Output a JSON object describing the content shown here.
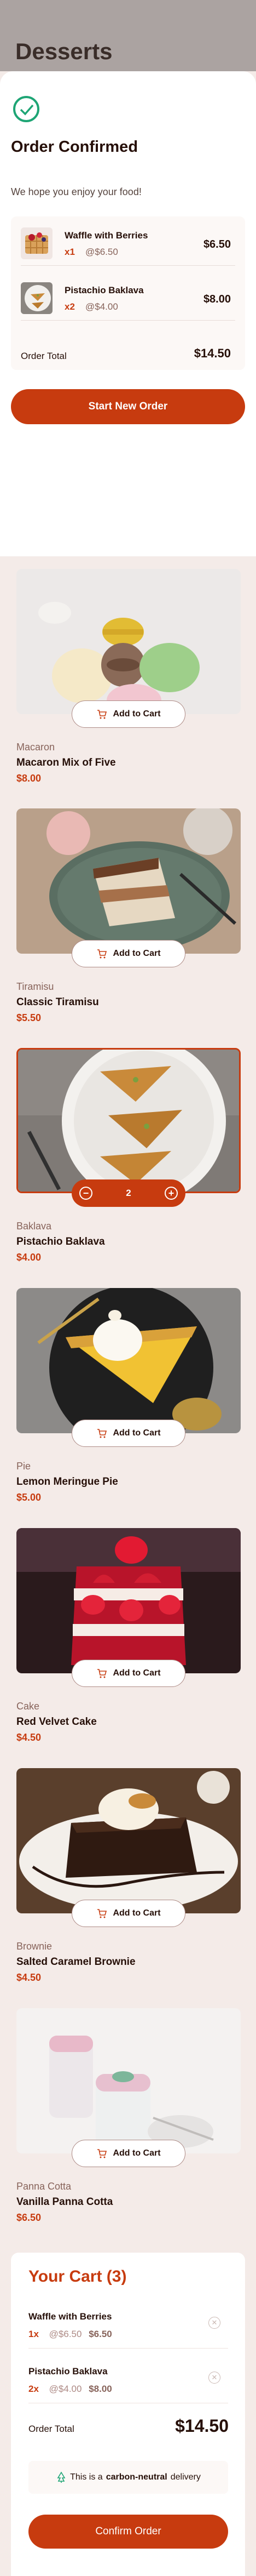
{
  "page": {
    "title": "Desserts"
  },
  "modal": {
    "title": "Order Confirmed",
    "subtitle": "We hope you enjoy your food!",
    "items": [
      {
        "name": "Waffle with Berries",
        "qty": "x1",
        "unit": "@$6.50",
        "total": "$6.50"
      },
      {
        "name": "Pistachio Baklava",
        "qty": "x2",
        "unit": "@$4.00",
        "total": "$8.00"
      }
    ],
    "order_total_label": "Order Total",
    "order_total_value": "$14.50",
    "start_button": "Start New Order"
  },
  "products": [
    {
      "category": "Macaron",
      "name": "Macaron Mix of Five",
      "price": "$8.00",
      "action": "Add to Cart"
    },
    {
      "category": "Tiramisu",
      "name": "Classic Tiramisu",
      "price": "$5.50",
      "action": "Add to Cart"
    },
    {
      "category": "Baklava",
      "name": "Pistachio Baklava",
      "price": "$4.00",
      "quantity": "2",
      "selected": true
    },
    {
      "category": "Pie",
      "name": "Lemon Meringue Pie",
      "price": "$5.00",
      "action": "Add to Cart"
    },
    {
      "category": "Cake",
      "name": "Red Velvet Cake",
      "price": "$4.50",
      "action": "Add to Cart"
    },
    {
      "category": "Brownie",
      "name": "Salted Caramel Brownie",
      "price": "$4.50",
      "action": "Add to Cart"
    },
    {
      "category": "Panna Cotta",
      "name": "Vanilla Panna Cotta",
      "price": "$6.50",
      "action": "Add to Cart"
    }
  ],
  "cart": {
    "title": "Your Cart (3)",
    "items": [
      {
        "name": "Waffle with Berries",
        "qty": "1x",
        "unit": "@$6.50",
        "total": "$6.50"
      },
      {
        "name": "Pistachio Baklava",
        "qty": "2x",
        "unit": "@$4.00",
        "total": "$8.00"
      }
    ],
    "order_total_label": "Order Total",
    "order_total_value": "$14.50",
    "carbon_prefix": "This is a",
    "carbon_bold": "carbon-neutral",
    "carbon_suffix": "delivery",
    "confirm_button": "Confirm Order"
  },
  "colors": {
    "accent": "#c73b0f",
    "success": "#1ea575",
    "background": "#f4ebe8",
    "text": "#260f08"
  },
  "icons": [
    "order-confirmed-icon",
    "add-to-cart-icon",
    "decrement-icon",
    "increment-icon",
    "remove-item-icon",
    "carbon-neutral-icon"
  ]
}
